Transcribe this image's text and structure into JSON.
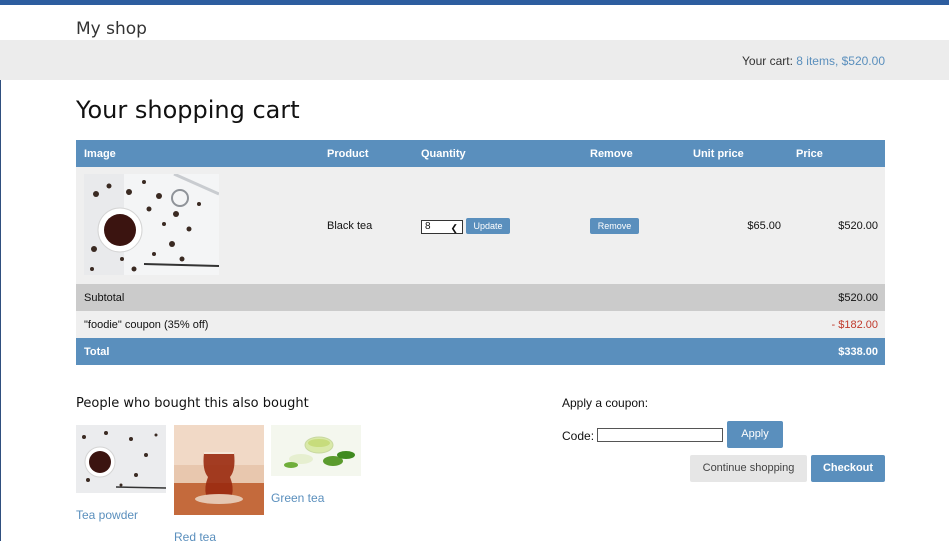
{
  "header": {
    "brand": "My shop"
  },
  "cart_summary": {
    "label": "Your cart:",
    "value": "8 items, $520.00"
  },
  "page_title": "Your shopping cart",
  "table": {
    "columns": [
      "Image",
      "Product",
      "Quantity",
      "Remove",
      "Unit price",
      "Price"
    ],
    "items": [
      {
        "product": "Black tea",
        "quantity": "8",
        "update_label": "Update",
        "remove_label": "Remove",
        "unit_price": "$65.00",
        "price": "$520.00",
        "image_icon": "black-tea-photo"
      }
    ],
    "subtotal": {
      "label": "Subtotal",
      "value": "$520.00"
    },
    "coupon": {
      "label": "\"foodie\" coupon (35% off)",
      "value": "- $182.00"
    },
    "total": {
      "label": "Total",
      "value": "$338.00"
    }
  },
  "also_bought": {
    "title": "People who bought this also bought",
    "items": [
      {
        "name": "Tea powder",
        "image_icon": "tea-powder-photo"
      },
      {
        "name": "Red tea",
        "image_icon": "red-tea-photo"
      },
      {
        "name": "Green tea",
        "image_icon": "green-tea-photo"
      }
    ]
  },
  "coupon_form": {
    "title": "Apply a coupon:",
    "code_label": "Code:",
    "code_value": "",
    "apply_label": "Apply"
  },
  "actions": {
    "continue_label": "Continue shopping",
    "checkout_label": "Checkout"
  },
  "colors": {
    "accent": "#5a8fbd",
    "topbar": "#2d5d9f",
    "discount": "#c0392b"
  }
}
